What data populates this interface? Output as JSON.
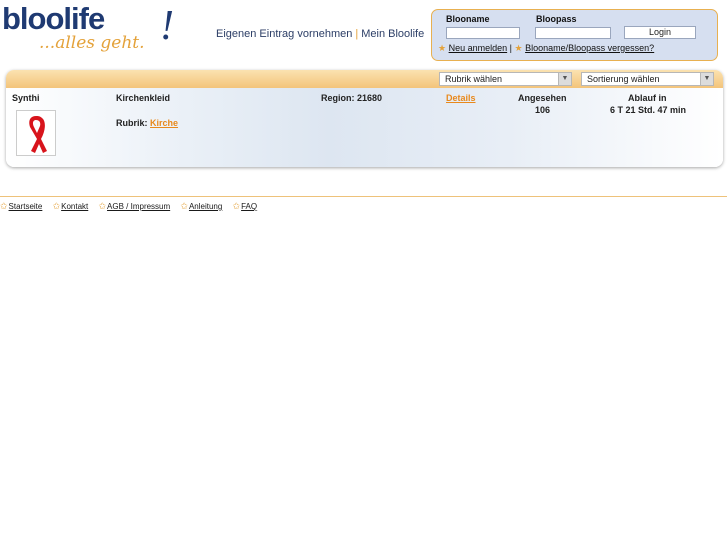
{
  "logo": {
    "main": "bloolife",
    "exclaim": "!",
    "sub": "...alles geht."
  },
  "header_nav": {
    "eintrag": "Eigenen Eintrag vornehmen",
    "separator": "|",
    "mein": "Mein Bloolife"
  },
  "login": {
    "name_label": "Blooname",
    "pass_label": "Bloopass",
    "button": "Login",
    "register": "Neu anmelden",
    "link_sep": "|",
    "forgot": "Blooname/Bloopass vergessen?"
  },
  "filters": {
    "rubrik": "Rubrik wählen",
    "sortierung": "Sortierung wählen"
  },
  "listing": {
    "user": "Synthi",
    "title": "Kirchenkleid",
    "rubrik_label": "Rubrik:",
    "rubrik_value": "Kirche",
    "region": "Region: 21680",
    "details": "Details",
    "viewed_label": "Angesehen",
    "viewed_value": "106",
    "expiry_label": "Ablauf in",
    "expiry_value": "6 T 21 Std. 47 min"
  },
  "footer": [
    "Startseite",
    "Kontakt",
    "AGB / Impressum",
    "Anleitung",
    "FAQ"
  ],
  "colors": {
    "brand_blue": "#1f3a72",
    "accent_orange": "#e4a23a",
    "link_orange": "#e8891c",
    "ribbon_red": "#d8141c"
  }
}
